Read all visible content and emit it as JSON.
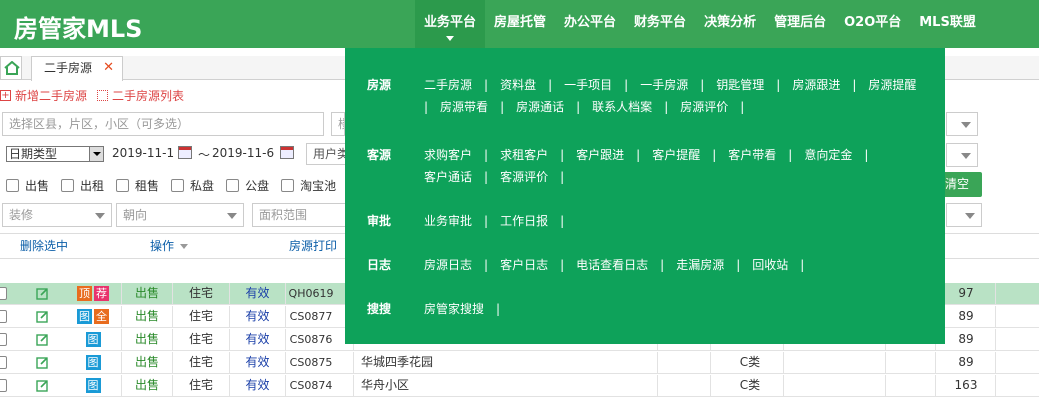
{
  "app": {
    "logo": "房管家MLS"
  },
  "nav": [
    {
      "label": "业务平台",
      "active": true
    },
    {
      "label": "房屋托管"
    },
    {
      "label": "办公平台"
    },
    {
      "label": "财务平台"
    },
    {
      "label": "决策分析"
    },
    {
      "label": "管理后台"
    },
    {
      "label": "O2O平台"
    },
    {
      "label": "MLS联盟"
    }
  ],
  "tabs": [
    {
      "label": "二手房源",
      "close": "✕"
    }
  ],
  "actions": {
    "add": "新增二手房源",
    "list": "二手房源列表"
  },
  "filters": {
    "region_placeholder": "选择区县，片区，小区（可多选）",
    "next_field_peek": "楼",
    "date_type": "日期类型",
    "date_from": "2019-11-1",
    "date_sep": "～",
    "date_to": "2019-11-6",
    "usage_peek": "用户类",
    "checkboxes": [
      "出售",
      "出租",
      "租售",
      "私盘",
      "公盘",
      "淘宝池"
    ],
    "decoration": "装修",
    "orientation": "朝向",
    "area_placeholder": "面积范围",
    "clear_button": "清空"
  },
  "grid": {
    "headers": {
      "delete_selected": "删除选中",
      "operation": "操作",
      "print": "房源打印"
    },
    "rows": [
      {
        "tags": [
          "顶",
          "荐"
        ],
        "tag_colors": [
          "#e86c1e",
          "#e8336c"
        ],
        "type": "出售",
        "usage": "住宅",
        "status": "有效",
        "code": "QH0619",
        "community": "",
        "grade": "",
        "score": "97",
        "highlight": true
      },
      {
        "tags": [
          "图",
          "全"
        ],
        "tag_colors": [
          "#1a9ad6",
          "#e86c1e"
        ],
        "type": "出售",
        "usage": "住宅",
        "status": "有效",
        "code": "CS0877",
        "community": "",
        "grade": "",
        "score": "89"
      },
      {
        "tags": [
          "图"
        ],
        "tag_colors": [
          "#1a9ad6"
        ],
        "type": "出售",
        "usage": "住宅",
        "status": "有效",
        "code": "CS0876",
        "community": "",
        "grade": "",
        "score": "89"
      },
      {
        "tags": [
          "图"
        ],
        "tag_colors": [
          "#1a9ad6"
        ],
        "type": "出售",
        "usage": "住宅",
        "status": "有效",
        "code": "CS0875",
        "community": "华城四季花园",
        "grade": "C类",
        "score": "89"
      },
      {
        "tags": [
          "图"
        ],
        "tag_colors": [
          "#1a9ad6"
        ],
        "type": "出售",
        "usage": "住宅",
        "status": "有效",
        "code": "CS0874",
        "community": "华舟小区",
        "grade": "C类",
        "score": "163"
      }
    ]
  },
  "dropdown": {
    "groups": [
      {
        "title": "房源",
        "links": [
          "二手房源",
          "资料盘",
          "一手项目",
          "一手房源",
          "钥匙管理",
          "房源跟进",
          "房源提醒",
          "房源带看",
          "房源通话",
          "联系人档案",
          "房源评价"
        ]
      },
      {
        "title": "客源",
        "links": [
          "求购客户",
          "求租客户",
          "客户跟进",
          "客户提醒",
          "客户带看",
          "意向定金",
          "客户通话",
          "客源评价"
        ]
      },
      {
        "title": "审批",
        "links": [
          "业务审批",
          "工作日报"
        ]
      },
      {
        "title": "日志",
        "links": [
          "房源日志",
          "客户日志",
          "电话查看日志",
          "走漏房源",
          "回收站"
        ]
      },
      {
        "title": "搜搜",
        "links": [
          "房管家搜搜"
        ]
      }
    ],
    "separator": "|"
  },
  "colors": {
    "brand": "#3aa557",
    "dropdown_bg": "#0ea25a",
    "row_highlight": "#b9e2c5"
  }
}
